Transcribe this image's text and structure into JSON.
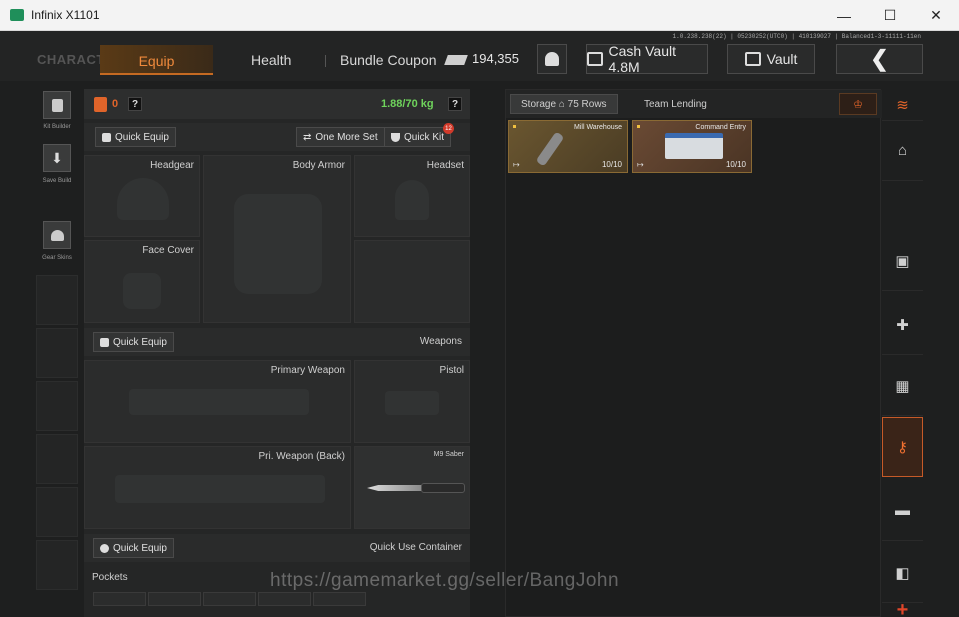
{
  "window": {
    "title": "Infinix X1101",
    "minimize": "—",
    "maximize": "☐",
    "close": "✕"
  },
  "topbar": {
    "tabs": {
      "character": "CHARACTER",
      "equip": "Equip",
      "health": "Health",
      "bundle": "Bundle Coupon"
    },
    "money": "194,355",
    "cash_vault": "Cash Vault 4.8M",
    "vault": "Vault",
    "back": "❮",
    "build_info": "1.0.238.238(22) | 05230252(UTC0) | 410139027 | Balanced1-3-11111-11en"
  },
  "left_rail": {
    "kit_builder": "Kit Builder",
    "save_build": "Save Build",
    "gear_skins": "Gear Skins"
  },
  "equip": {
    "bag_count": "0",
    "help": "?",
    "weight": "1.88/70 kg",
    "quick_equip": "Quick Equip",
    "one_more_set": "One More Set",
    "quick_kit": "Quick Kit",
    "quick_kit_badge": "12",
    "slots": {
      "headgear": "Headgear",
      "body_armor": "Body Armor",
      "headset": "Headset",
      "face_cover": "Face Cover",
      "primary_weapon": "Primary Weapon",
      "pistol": "Pistol",
      "pri_weapon_back": "Pri. Weapon (Back)",
      "melee": "M9 Saber"
    },
    "weapons_title": "Weapons",
    "quick_use_container": "Quick Use Container",
    "pockets": "Pockets"
  },
  "storage": {
    "tab_storage": "Storage",
    "rows": "75 Rows",
    "tab_lending": "Team Lending",
    "items": [
      {
        "name": "Mill Warehouse",
        "count": "10/10"
      },
      {
        "name": "Command Entry",
        "count": "10/10"
      }
    ]
  },
  "right_rail": {
    "plus": "+"
  },
  "watermark": "https://gamemarket.gg/seller/BangJohn"
}
